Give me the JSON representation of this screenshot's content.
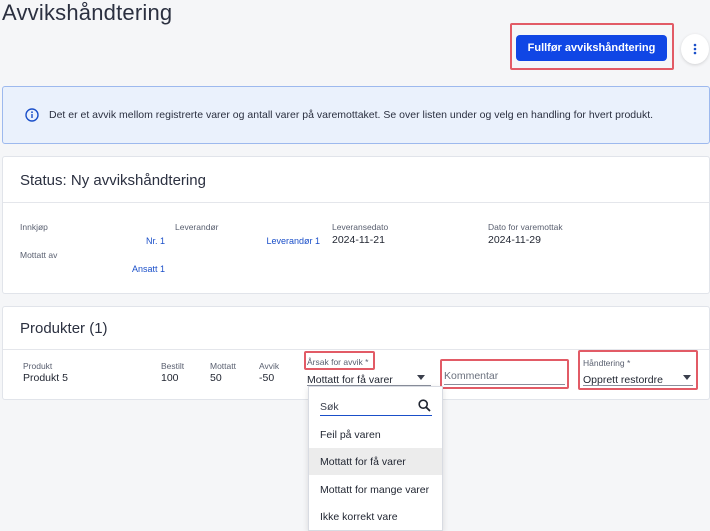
{
  "page": {
    "title": "Avvikshåndtering"
  },
  "header": {
    "complete_button": "Fullfør avvikshåndtering",
    "more_icon": "vertical-dots-icon"
  },
  "banner": {
    "icon": "info-icon",
    "text": "Det er et avvik mellom registrerte varer og antall varer på varemottaket. Se over listen under og velg en handling for hvert produkt."
  },
  "status": {
    "title": "Status: Ny avvikshåndtering",
    "fields": {
      "innkjop_label": "Innkjøp",
      "innkjop_value": "Nr. 1",
      "leverandor_label": "Leverandør",
      "leverandor_value": "Leverandør 1",
      "leveransedato_label": "Leveransedato",
      "leveransedato_value": "2024-11-21",
      "varemottak_label": "Dato for varemottak",
      "varemottak_value": "2024-11-29",
      "mottatt_av_label": "Mottatt av",
      "mottatt_av_value": "Ansatt 1"
    }
  },
  "products": {
    "title": "Produkter (1)",
    "columns": {
      "produkt": "Produkt",
      "bestilt": "Bestilt",
      "mottatt": "Mottatt",
      "avvik": "Avvik",
      "arsak": "Årsak for avvik *",
      "handtering": "Håndtering *"
    },
    "row": {
      "produkt": "Produkt 5",
      "bestilt": "100",
      "mottatt": "50",
      "avvik": "-50",
      "arsak": "Mottatt for få varer",
      "kommentar_placeholder": "Kommentar",
      "handtering": "Opprett restordre"
    }
  },
  "dropdown": {
    "search_placeholder": "Søk",
    "options": [
      "Feil på varen",
      "Mottatt for få varer",
      "Mottatt for mange varer",
      "Ikke korrekt vare"
    ],
    "selected": "Mottatt for få varer"
  },
  "colors": {
    "primary": "#1046e5",
    "highlight": "#e25b66",
    "banner_bg": "#eaf1fc",
    "link": "#1a4fc9"
  }
}
